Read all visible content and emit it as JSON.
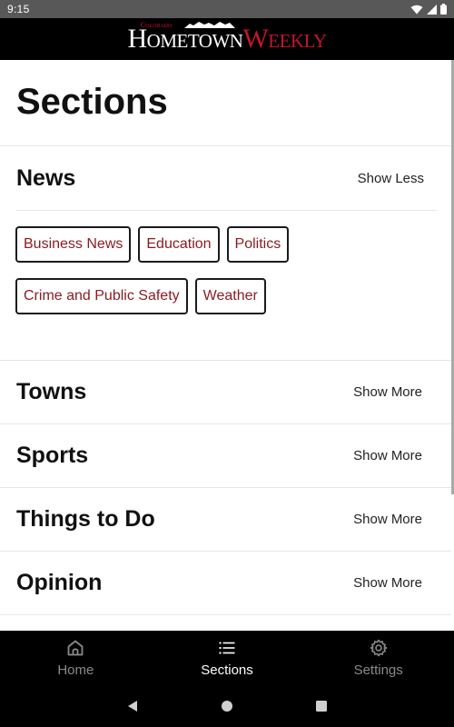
{
  "status_bar": {
    "time": "9:15"
  },
  "header": {
    "logo_small": "Colorado",
    "logo_main": "Hometown",
    "logo_accent": "Weekly"
  },
  "page": {
    "title": "Sections"
  },
  "sections": [
    {
      "name": "News",
      "toggle": "Show Less",
      "expanded": true,
      "chips": [
        "Business News",
        "Education",
        "Politics",
        "Crime and Public Safety",
        "Weather"
      ]
    },
    {
      "name": "Towns",
      "toggle": "Show More",
      "expanded": false
    },
    {
      "name": "Sports",
      "toggle": "Show More",
      "expanded": false
    },
    {
      "name": "Things to Do",
      "toggle": "Show More",
      "expanded": false
    },
    {
      "name": "Opinion",
      "toggle": "Show More",
      "expanded": false
    }
  ],
  "bottom_nav": [
    {
      "label": "Home",
      "icon": "home-icon",
      "active": false
    },
    {
      "label": "Sections",
      "icon": "list-icon",
      "active": true
    },
    {
      "label": "Settings",
      "icon": "gear-icon",
      "active": false
    }
  ],
  "colors": {
    "header_bg": "#000000",
    "accent_red": "#c2162b",
    "chip_text": "#8b1a1f",
    "nav_active": "#ffffff",
    "nav_inactive": "#8a8a8a"
  }
}
